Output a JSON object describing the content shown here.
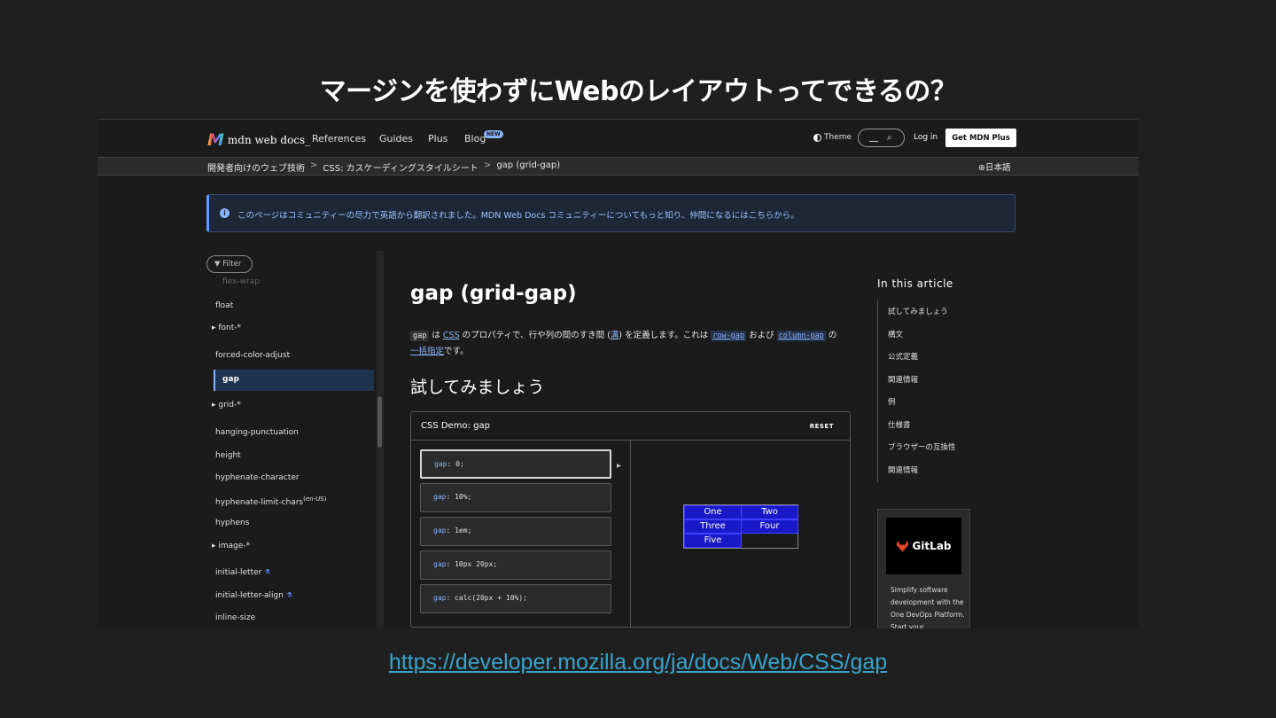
{
  "slide": {
    "title": "マージンを使わずにWebのレイアウトってできるの？",
    "url": "https://developer.mozilla.org/ja/docs/Web/CSS/gap"
  },
  "nav": {
    "logo_mark": "M",
    "logo_text": "mdn web docs_",
    "links": [
      "References",
      "Guides",
      "Plus",
      "Blog"
    ],
    "blog_badge": "NEW",
    "theme_label": "Theme",
    "login_label": "Log in",
    "get_plus_label": "Get MDN Plus"
  },
  "breadcrumb": {
    "items": [
      "開発者向けのウェブ技術",
      "CSS: カスケーディングスタイルシート",
      "gap (grid-gap)"
    ],
    "separator": ">",
    "language": "日本語"
  },
  "notice": {
    "icon": "i",
    "text": "このページはコミュニティーの尽力で英語から翻訳されました。MDN Web Docs コミュニティーについてもっと知り、仲間になるにはこちらから。"
  },
  "sidebar": {
    "filter_label": "Filter",
    "faded_item": "flex-wrap",
    "items": [
      {
        "label": "float"
      },
      {
        "label": "▸ font-*"
      },
      {
        "label": "forced-color-adjust"
      },
      {
        "label": "gap",
        "active": true
      },
      {
        "label": "▸ grid-*"
      },
      {
        "label": "hanging-punctuation"
      },
      {
        "label": "height"
      },
      {
        "label": "hyphenate-character"
      },
      {
        "label": "hyphenate-limit-chars",
        "sup": "(en-US)"
      },
      {
        "label": "hyphens"
      },
      {
        "label": "▸ image-*"
      },
      {
        "label": "initial-letter",
        "flask": true
      },
      {
        "label": "initial-letter-align",
        "flask": true
      },
      {
        "label": "inline-size"
      }
    ]
  },
  "article": {
    "title": "gap (grid-gap)",
    "para": {
      "code_gap": "gap",
      "t1": " は ",
      "css_link": "CSS",
      "t2": " のプロパティで、行や列の間のすき間 (",
      "gutter_link": "溝",
      "t3": ") を定義します。これは ",
      "row_gap": "row-gap",
      "t4": " および ",
      "column_gap": "column-gap",
      "t5": " の",
      "shorthand_link": "一括指定",
      "t6": "です。"
    },
    "try_heading": "試してみましょう"
  },
  "demo": {
    "title": "CSS Demo: gap",
    "reset_label": "RESET",
    "options": [
      {
        "prop": "gap",
        "value": ": 0;",
        "selected": true
      },
      {
        "prop": "gap",
        "value": ": 10%;"
      },
      {
        "prop": "gap",
        "value": ": 1em;"
      },
      {
        "prop": "gap",
        "value": ": 10px 20px;"
      },
      {
        "prop": "gap",
        "value": ": calc(20px + 10%);"
      }
    ],
    "cells": [
      "One",
      "Two",
      "Three",
      "Four",
      "Five"
    ]
  },
  "toc": {
    "title": "In this article",
    "items": [
      "試してみましょう",
      "構文",
      "公式定義",
      "関連情報",
      "例",
      "仕様書",
      "ブラウザーの互換性",
      "関連情報"
    ]
  },
  "ad": {
    "brand": "GitLab",
    "text": "Simplify software development with the One DevOps Platform. Start your"
  }
}
